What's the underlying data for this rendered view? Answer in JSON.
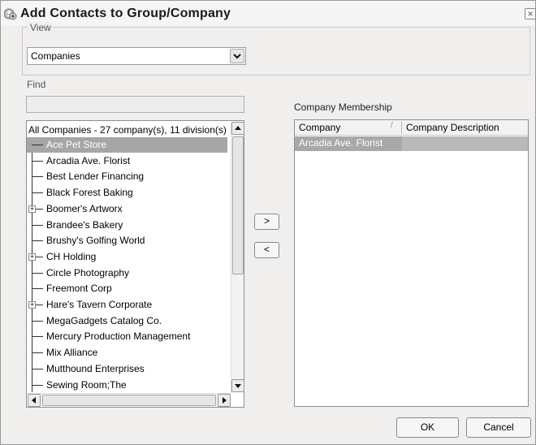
{
  "window": {
    "title": "Add Contacts to Group/Company",
    "close_glyph": "×"
  },
  "view": {
    "legend": "View",
    "selected": "Companies"
  },
  "find": {
    "label": "Find",
    "value": ""
  },
  "tree": {
    "header": "All Companies - 27 company(s), 11 division(s)",
    "items": [
      {
        "label": "Ace Pet Store",
        "selected": true,
        "expandable": false
      },
      {
        "label": "Arcadia Ave. Florist",
        "selected": false,
        "expandable": false
      },
      {
        "label": "Best Lender Financing",
        "selected": false,
        "expandable": false
      },
      {
        "label": "Black Forest Baking",
        "selected": false,
        "expandable": false
      },
      {
        "label": "Boomer's Artworx",
        "selected": false,
        "expandable": true
      },
      {
        "label": "Brandee's Bakery",
        "selected": false,
        "expandable": false
      },
      {
        "label": "Brushy's Golfing World",
        "selected": false,
        "expandable": false
      },
      {
        "label": "CH Holding",
        "selected": false,
        "expandable": true
      },
      {
        "label": "Circle Photography",
        "selected": false,
        "expandable": false
      },
      {
        "label": "Freemont Corp",
        "selected": false,
        "expandable": false
      },
      {
        "label": "Hare's Tavern Corporate",
        "selected": false,
        "expandable": true
      },
      {
        "label": "MegaGadgets Catalog Co.",
        "selected": false,
        "expandable": false
      },
      {
        "label": "Mercury Production Management",
        "selected": false,
        "expandable": false
      },
      {
        "label": "Mix Alliance",
        "selected": false,
        "expandable": false
      },
      {
        "label": "Mutthound Enterprises",
        "selected": false,
        "expandable": false
      },
      {
        "label": "Sewing Room;The",
        "selected": false,
        "expandable": false
      }
    ]
  },
  "move": {
    "add_label": ">",
    "remove_label": "<"
  },
  "membership": {
    "label": "Company Membership",
    "columns": [
      "Company",
      "Company Description"
    ],
    "rows": [
      {
        "company": "Arcadia Ave. Florist",
        "description": ""
      }
    ]
  },
  "buttons": {
    "ok": "OK",
    "cancel": "Cancel"
  },
  "icons": {
    "title": "contacts-group-icon",
    "dropdown": "chevron-down-icon",
    "scroll_up": "arrow-up-icon",
    "scroll_down": "arrow-down-icon",
    "scroll_left": "arrow-left-icon",
    "scroll_right": "arrow-right-icon",
    "sort": "sort-icon"
  },
  "colors": {
    "selection": "#a6a6a6",
    "dialog_bg": "#f0efee"
  }
}
